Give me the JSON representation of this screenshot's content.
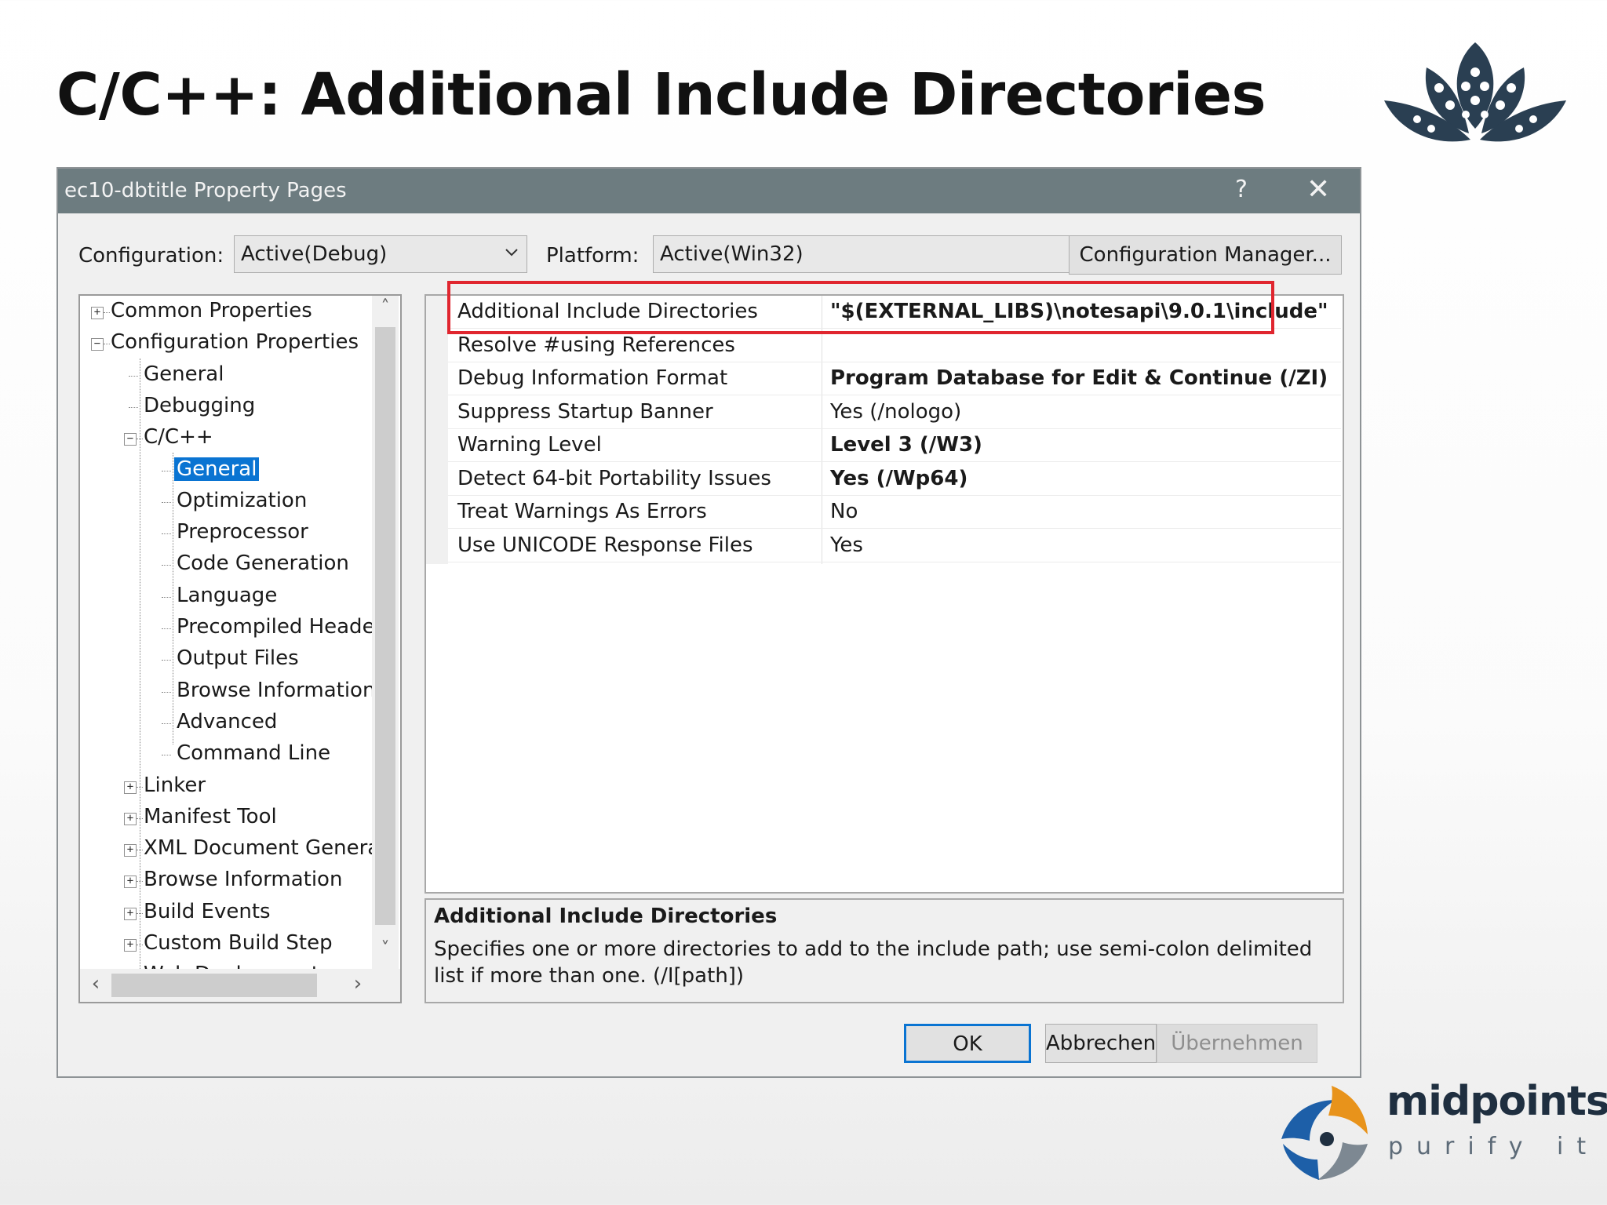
{
  "slide": {
    "title": "C/C++: Additional Include Directories",
    "logo_company": "midpoints",
    "logo_tagline": "purify it",
    "brand_color": "#1f2f40"
  },
  "dialog": {
    "title": "ec10-dbtitle Property Pages",
    "help_glyph": "?",
    "close_glyph": "✕",
    "configuration_label": "Configuration:",
    "configuration_value": "Active(Debug)",
    "platform_label": "Platform:",
    "platform_value": "Active(Win32)",
    "config_manager_button": "Configuration Manager...",
    "ok_button": "OK",
    "cancel_button": "Abbrechen",
    "apply_button": "Übernehmen",
    "titlebar_color": "#6d7c80",
    "selection_color": "#0a74d2",
    "highlight_color": "#e0262f"
  },
  "tree": {
    "items": [
      {
        "label": "Common Properties",
        "level": 0,
        "expander": "plus"
      },
      {
        "label": "Configuration Properties",
        "level": 0,
        "expander": "minus"
      },
      {
        "label": "General",
        "level": 1,
        "expander": "none"
      },
      {
        "label": "Debugging",
        "level": 1,
        "expander": "none"
      },
      {
        "label": "C/C++",
        "level": 1,
        "expander": "minus"
      },
      {
        "label": "General",
        "level": 2,
        "expander": "none",
        "selected": true
      },
      {
        "label": "Optimization",
        "level": 2,
        "expander": "none"
      },
      {
        "label": "Preprocessor",
        "level": 2,
        "expander": "none"
      },
      {
        "label": "Code Generation",
        "level": 2,
        "expander": "none"
      },
      {
        "label": "Language",
        "level": 2,
        "expander": "none"
      },
      {
        "label": "Precompiled Heade",
        "level": 2,
        "expander": "none"
      },
      {
        "label": "Output Files",
        "level": 2,
        "expander": "none"
      },
      {
        "label": "Browse Information",
        "level": 2,
        "expander": "none"
      },
      {
        "label": "Advanced",
        "level": 2,
        "expander": "none"
      },
      {
        "label": "Command Line",
        "level": 2,
        "expander": "none"
      },
      {
        "label": "Linker",
        "level": 1,
        "expander": "plus"
      },
      {
        "label": "Manifest Tool",
        "level": 1,
        "expander": "plus"
      },
      {
        "label": "XML Document Genera",
        "level": 1,
        "expander": "plus"
      },
      {
        "label": "Browse Information",
        "level": 1,
        "expander": "plus"
      },
      {
        "label": "Build Events",
        "level": 1,
        "expander": "plus"
      },
      {
        "label": "Custom Build Step",
        "level": 1,
        "expander": "plus"
      },
      {
        "label": "Web Deployment",
        "level": 1,
        "expander": "plus"
      }
    ]
  },
  "properties": {
    "rows": [
      {
        "name": "Additional Include Directories",
        "value": "\"$(EXTERNAL_LIBS)\\notesapi\\9.0.1\\include\"",
        "bold": true
      },
      {
        "name": "Resolve #using References",
        "value": "",
        "bold": false
      },
      {
        "name": "Debug Information Format",
        "value": "Program Database for Edit & Continue (/ZI)",
        "bold": true
      },
      {
        "name": "Suppress Startup Banner",
        "value": "Yes (/nologo)",
        "bold": false
      },
      {
        "name": "Warning Level",
        "value": "Level 3 (/W3)",
        "bold": true
      },
      {
        "name": "Detect 64-bit Portability Issues",
        "value": "Yes (/Wp64)",
        "bold": true
      },
      {
        "name": "Treat Warnings As Errors",
        "value": "No",
        "bold": false
      },
      {
        "name": "Use UNICODE Response Files",
        "value": "Yes",
        "bold": false
      }
    ]
  },
  "description": {
    "title": "Additional Include Directories",
    "text": "Specifies one or more directories to add to the include path; use semi-colon delimited list if more than one.     (/I[path])"
  }
}
